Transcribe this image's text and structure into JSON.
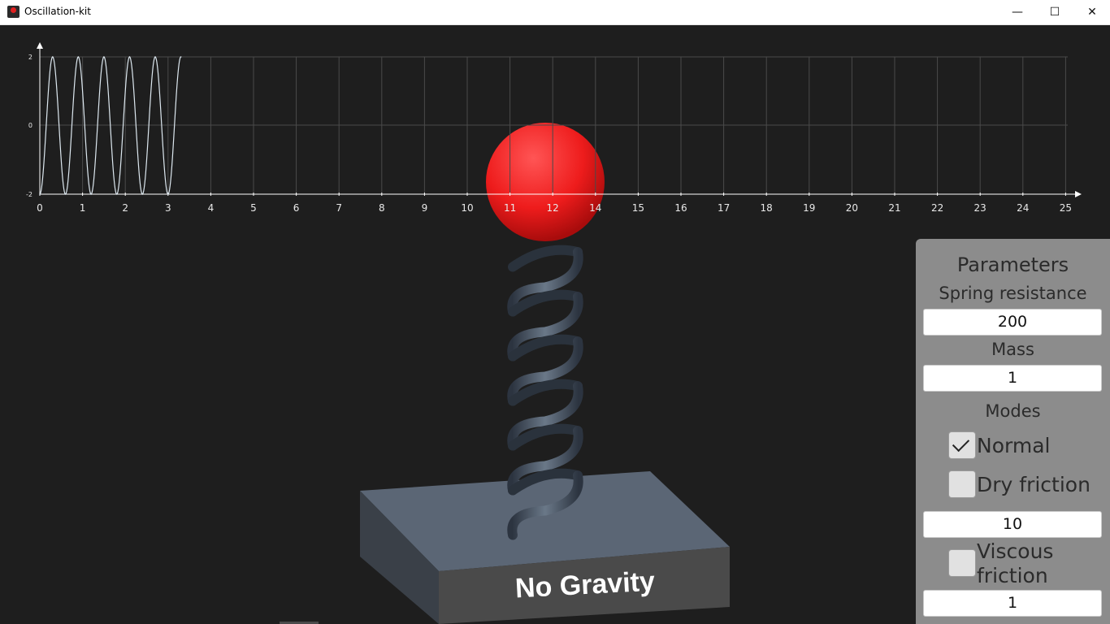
{
  "window": {
    "title": "Oscillation-kit",
    "minimize_glyph": "—",
    "maximize_glyph": "☐",
    "close_glyph": "✕"
  },
  "graph": {
    "y_ticks": [
      "2",
      "0",
      "-2"
    ],
    "x_ticks": [
      "0",
      "1",
      "2",
      "3",
      "4",
      "5",
      "6",
      "7",
      "8",
      "9",
      "10",
      "11",
      "12",
      "14",
      "15",
      "16",
      "17",
      "18",
      "19",
      "20",
      "21",
      "22",
      "23",
      "24",
      "25"
    ]
  },
  "chart_data": {
    "type": "line",
    "series": [
      {
        "x": [
          0,
          0.3,
          0.6,
          0.9,
          1.2,
          1.5,
          1.8,
          2.1,
          2.4,
          2.7,
          3.0,
          3.3
        ],
        "y": [
          -2,
          2,
          -2,
          2,
          -2,
          2,
          -2,
          2,
          -2,
          2,
          -2,
          2
        ]
      }
    ],
    "xlim": [
      0,
      25
    ],
    "ylim": [
      -2,
      2
    ],
    "grid": true
  },
  "scene": {
    "base_label": "No Gravity",
    "ball_color": "#ff2a2a"
  },
  "panel": {
    "title": "Parameters",
    "spring_label": "Spring resistance",
    "spring_value": "200",
    "mass_label": "Mass",
    "mass_value": "1",
    "modes_label": "Modes",
    "normal_label": "Normal",
    "normal_checked": true,
    "dry_label": "Dry friction",
    "dry_checked": false,
    "dry_value": "10",
    "viscous_label": "Viscous\nfriction",
    "viscous_checked": false,
    "viscous_value": "1"
  }
}
